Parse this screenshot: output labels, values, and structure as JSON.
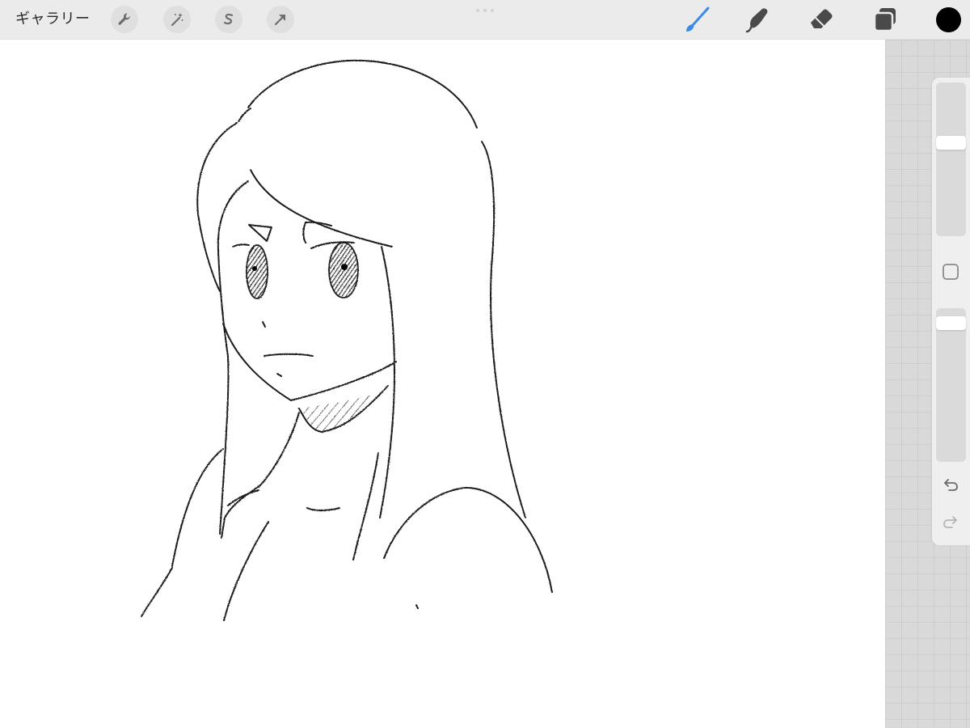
{
  "toolbar": {
    "gallery_label": "ギャラリー",
    "left_tools": [
      "wrench-icon",
      "magic-wand-icon",
      "selection-s-icon",
      "move-arrow-icon"
    ],
    "right_tools": [
      "brush-icon",
      "smudge-icon",
      "eraser-icon",
      "layers-icon"
    ],
    "active_tool": "brush-icon",
    "active_tool_color": "#3b8be6",
    "current_color": "#000000"
  },
  "sidebar": {
    "brush_size": 0.62,
    "opacity": 0.95,
    "modify_icon": "square-icon",
    "undo_icon": "undo-icon",
    "redo_icon": "redo-icon"
  },
  "canvas": {
    "stroke_color": "#1c1c1c"
  }
}
